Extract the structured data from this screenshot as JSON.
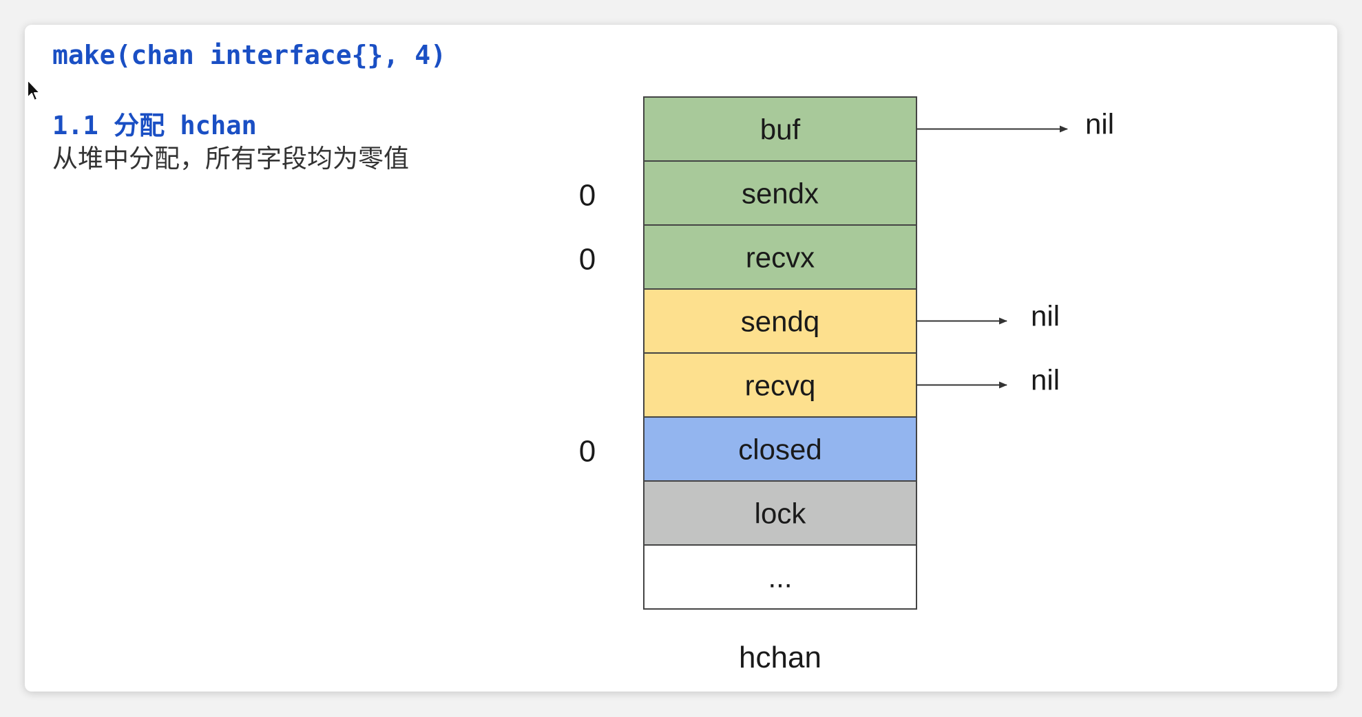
{
  "code": "make(chan interface{}, 4)",
  "section": {
    "title": "1.1 分配 hchan",
    "description": "从堆中分配，所有字段均为零值"
  },
  "struct_name": "hchan",
  "fields": [
    {
      "name": "buf",
      "color": "#a8c99a",
      "side_value": "",
      "arrow_target": "nil"
    },
    {
      "name": "sendx",
      "color": "#a8c99a",
      "side_value": "0",
      "arrow_target": ""
    },
    {
      "name": "recvx",
      "color": "#a8c99a",
      "side_value": "0",
      "arrow_target": ""
    },
    {
      "name": "sendq",
      "color": "#fde08e",
      "side_value": "",
      "arrow_target": "nil"
    },
    {
      "name": "recvq",
      "color": "#fde08e",
      "side_value": "",
      "arrow_target": "nil"
    },
    {
      "name": "closed",
      "color": "#93b5ef",
      "side_value": "0",
      "arrow_target": ""
    },
    {
      "name": "lock",
      "color": "#c2c3c2",
      "side_value": "",
      "arrow_target": ""
    },
    {
      "name": "...",
      "color": "#ffffff",
      "side_value": "",
      "arrow_target": ""
    }
  ],
  "colors": {
    "accent_text": "#1a4fc4",
    "border": "#444444"
  }
}
